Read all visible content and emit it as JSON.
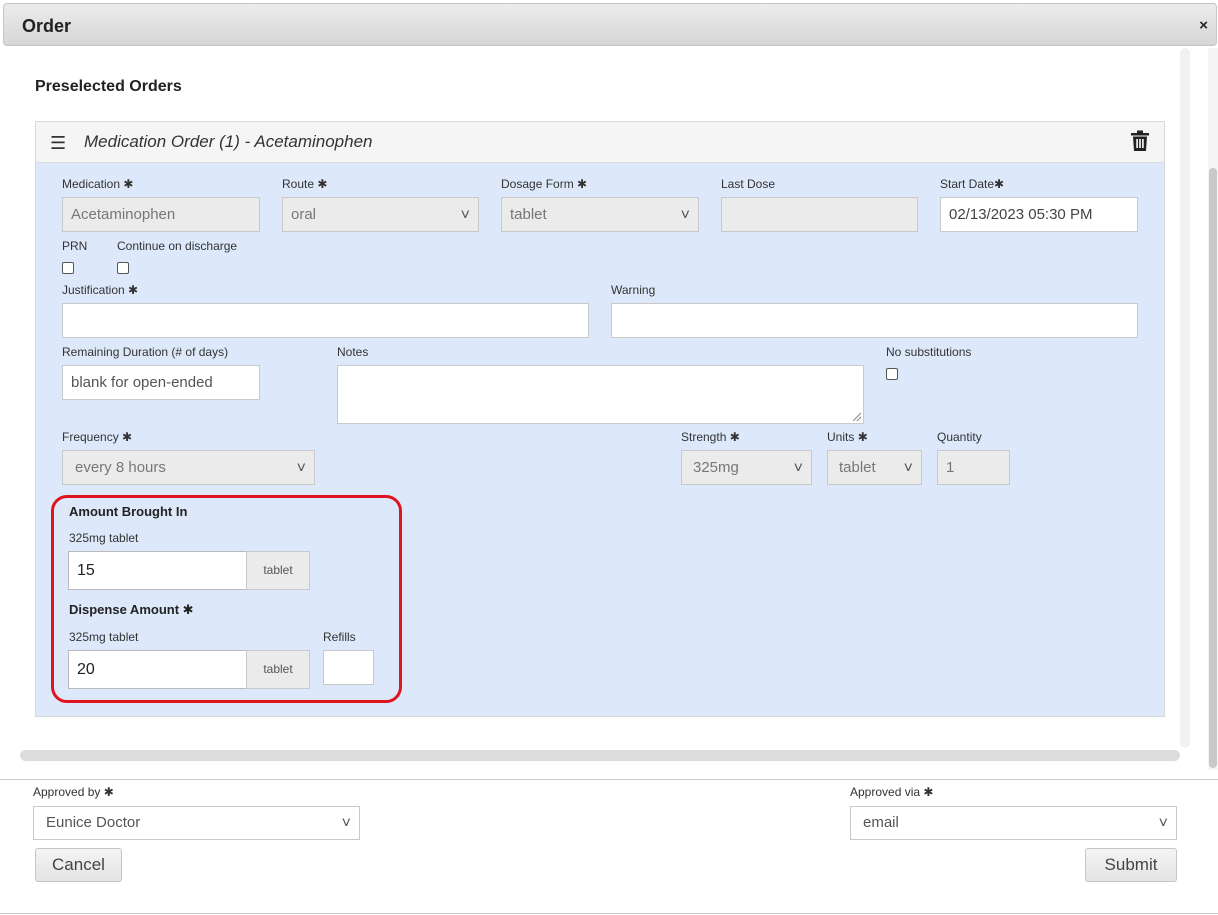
{
  "window": {
    "title": "Order",
    "close_glyph": "×"
  },
  "section_title": "Preselected Orders",
  "order": {
    "header_title": "Medication Order (1) - Acetaminophen",
    "icons": {
      "menu": "hamburger-icon",
      "delete": "trash-icon"
    },
    "medication": {
      "label": "Medication",
      "value": "Acetaminophen"
    },
    "route": {
      "label": "Route",
      "value": "oral"
    },
    "dosage_form": {
      "label": "Dosage Form",
      "value": "tablet"
    },
    "last_dose": {
      "label": "Last Dose",
      "value": ""
    },
    "start_date": {
      "label": "Start Date",
      "value": "02/13/2023 05:30 PM"
    },
    "prn": {
      "label": "PRN"
    },
    "continue_on_discharge": {
      "label": "Continue on discharge"
    },
    "justification": {
      "label": "Justification",
      "value": ""
    },
    "warning": {
      "label": "Warning",
      "value": ""
    },
    "remaining_duration": {
      "label": "Remaining Duration (# of days)",
      "placeholder": "blank for open-ended"
    },
    "notes": {
      "label": "Notes"
    },
    "no_substitutions": {
      "label": "No substitutions"
    },
    "frequency": {
      "label": "Frequency",
      "value": "every 8 hours"
    },
    "strength": {
      "label": "Strength",
      "value": "325mg"
    },
    "units": {
      "label": "Units",
      "value": "tablet"
    },
    "quantity": {
      "label": "Quantity",
      "value": "1"
    },
    "amount_brought_in": {
      "label": "Amount Brought In",
      "sublabel": "325mg tablet",
      "value": "15",
      "unit": "tablet"
    },
    "dispense_amount": {
      "label": "Dispense Amount",
      "sublabel": "325mg tablet",
      "value": "20",
      "unit": "tablet"
    },
    "refills": {
      "label": "Refills",
      "value": ""
    }
  },
  "footer": {
    "approved_by": {
      "label": "Approved by",
      "value": "Eunice Doctor"
    },
    "approved_via": {
      "label": "Approved via",
      "value": "email"
    },
    "cancel_label": "Cancel",
    "submit_label": "Submit"
  },
  "required_marker": "✱",
  "colors": {
    "highlight": "#e0141e",
    "panel": "#dde9fb"
  }
}
